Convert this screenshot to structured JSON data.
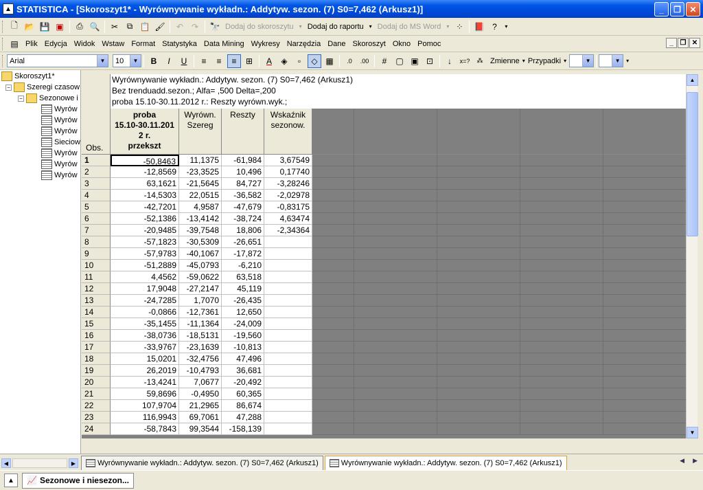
{
  "window": {
    "title": "STATISTICA - [Skoroszyt1* - Wyrównywanie wykładn.: Addytyw. sezon. (7) S0=7,462 (Arkusz1)]"
  },
  "toolbar": {
    "dodaj_do_skoroszytu": "Dodaj do skoroszytu",
    "dodaj_do_raportu": "Dodaj do raportu",
    "dodaj_do_ms_word": "Dodaj do MS Word"
  },
  "menu": [
    "Plik",
    "Edycja",
    "Widok",
    "Wstaw",
    "Format",
    "Statystyka",
    "Data Mining",
    "Wykresy",
    "Narzędzia",
    "Dane",
    "Skoroszyt",
    "Okno",
    "Pomoc"
  ],
  "format_bar": {
    "font": "Arial",
    "size": "10",
    "zmienne": "Zmienne",
    "przypadki": "Przypadki"
  },
  "tree": {
    "root": "Skoroszyt1*",
    "group": "Szeregi czasow",
    "subgroup": "Sezonowe i",
    "items": [
      "Wyrów",
      "Wyrów",
      "Wyrów",
      "Sieciow",
      "Wyrów",
      "Wyrów",
      "Wyrów"
    ]
  },
  "sheet": {
    "header_lines": [
      "Wyrównywanie wykładn.: Addytyw. sezon. (7) S0=7,462 (Arkusz1)",
      "Bez trenduadd.sezon.; Alfa= ,500 Delta=,200",
      "proba 15.10-30.11.2012 r.: Reszty wyrówn.wyk.;"
    ],
    "obs_label": "Obs.",
    "columns": [
      [
        "proba",
        "15.10-30.11.201",
        "2 r.",
        "przekszt"
      ],
      [
        "Wyrówn.",
        "Szereg"
      ],
      [
        "Reszty"
      ],
      [
        "Wskaźnik",
        "sezonow."
      ]
    ],
    "rows": [
      [
        "1",
        "-50,8463",
        "11,1375",
        "-61,984",
        "3,67549"
      ],
      [
        "2",
        "-12,8569",
        "-23,3525",
        "10,496",
        "0,17740"
      ],
      [
        "3",
        "63,1621",
        "-21,5645",
        "84,727",
        "-3,28246"
      ],
      [
        "4",
        "-14,5303",
        "22,0515",
        "-36,582",
        "-2,02978"
      ],
      [
        "5",
        "-42,7201",
        "4,9587",
        "-47,679",
        "-0,83175"
      ],
      [
        "6",
        "-52,1386",
        "-13,4142",
        "-38,724",
        "4,63474"
      ],
      [
        "7",
        "-20,9485",
        "-39,7548",
        "18,806",
        "-2,34364"
      ],
      [
        "8",
        "-57,1823",
        "-30,5309",
        "-26,651",
        ""
      ],
      [
        "9",
        "-57,9783",
        "-40,1067",
        "-17,872",
        ""
      ],
      [
        "10",
        "-51,2889",
        "-45,0793",
        "-6,210",
        ""
      ],
      [
        "11",
        "4,4562",
        "-59,0622",
        "63,518",
        ""
      ],
      [
        "12",
        "17,9048",
        "-27,2147",
        "45,119",
        ""
      ],
      [
        "13",
        "-24,7285",
        "1,7070",
        "-26,435",
        ""
      ],
      [
        "14",
        "-0,0866",
        "-12,7361",
        "12,650",
        ""
      ],
      [
        "15",
        "-35,1455",
        "-11,1364",
        "-24,009",
        ""
      ],
      [
        "16",
        "-38,0736",
        "-18,5131",
        "-19,560",
        ""
      ],
      [
        "17",
        "-33,9767",
        "-23,1639",
        "-10,813",
        ""
      ],
      [
        "18",
        "15,0201",
        "-32,4756",
        "47,496",
        ""
      ],
      [
        "19",
        "26,2019",
        "-10,4793",
        "36,681",
        ""
      ],
      [
        "20",
        "-13,4241",
        "7,0677",
        "-20,492",
        ""
      ],
      [
        "21",
        "59,8696",
        "-0,4950",
        "60,365",
        ""
      ],
      [
        "22",
        "107,9704",
        "21,2965",
        "86,674",
        ""
      ],
      [
        "23",
        "116,9943",
        "69,7061",
        "47,288",
        ""
      ],
      [
        "24",
        "-58,7843",
        "99,3544",
        "-158,139",
        ""
      ]
    ]
  },
  "tabs": [
    "Wyrównywanie wykładn.: Addytyw. sezon. (7) S0=7,462 (Arkusz1)",
    "Wyrównywanie wykładn.: Addytyw. sezon. (7) S0=7,462 (Arkusz1)"
  ],
  "taskbar": {
    "button": "Sezonowe i niesezon..."
  }
}
